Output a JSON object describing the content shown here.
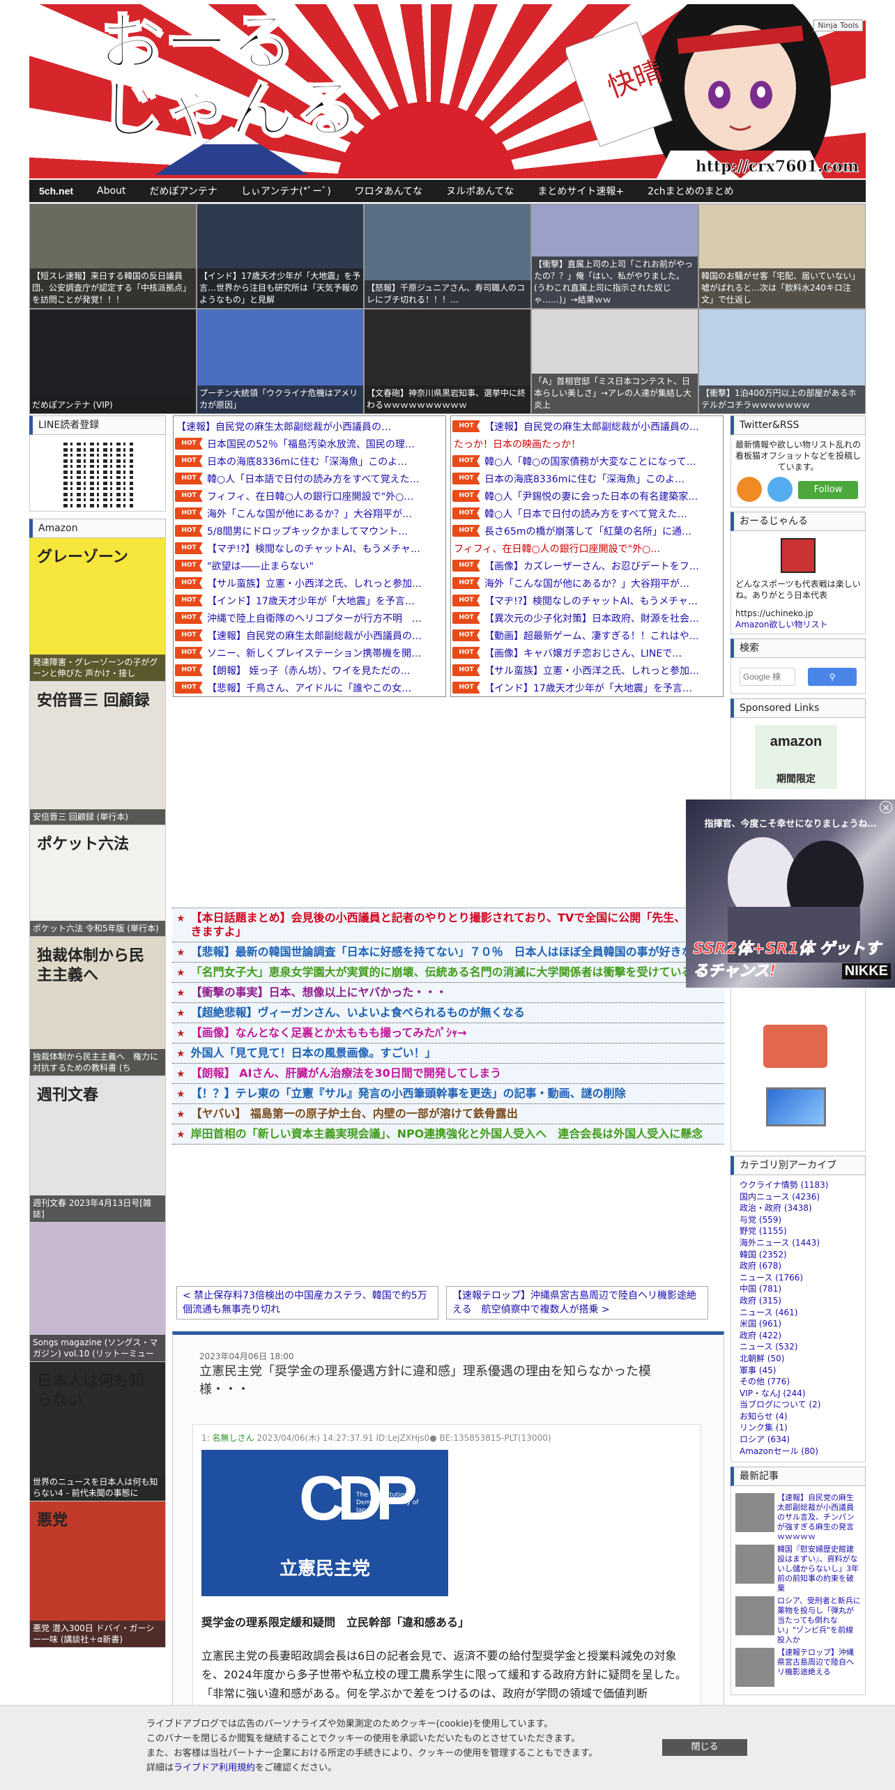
{
  "header": {
    "logo_text": "おーる\nじゃんる",
    "url_text": "http://crx7601.com",
    "ninja_tools": "Ninja Tools"
  },
  "nav": [
    "5ch.net",
    "About",
    "だめぽアンテナ",
    "しぃアンテナ(*ﾟーﾟ)",
    "ワロタあんてな",
    "ヌルポあんてな",
    "まとめサイト速報+",
    "2chまとめのまとめ"
  ],
  "thumbs": [
    {
      "caption": "【短スレ速報】来日する韓国の反日議員団、公安調査庁が認定する「中核派拠点」を訪問ことが発覚！！！",
      "bg": "#6b6a5f"
    },
    {
      "caption": "【インド】17歳天才少年が「大地震」を予言…世界から注目も研究所は「天気予報のようなもの」と見解",
      "bg": "#2e3b4e"
    },
    {
      "caption": "【怒報】千原ジュニアさん、寿司職人のコレにブチ切れる！！！…",
      "bg": "#5a6e84"
    },
    {
      "caption": "【衝撃】直属上司の上司「これお前がやったの？？」俺「はい、私がやりました。(うわこれ直属上司に指示された奴じゃ……)」→結果ｗｗ",
      "bg": "#9aa0c8"
    },
    {
      "caption": "韓国のお騒がせ客「宅配、届いていない」嘘がばれると…次は「飲料水240キロ注文」で仕返し",
      "bg": "#d9cbb0"
    },
    {
      "caption": "だめぽアンテナ (VIP)",
      "bg": "#1f1f24"
    },
    {
      "caption": "プーチン大統領「ウクライナ危機はアメリカが原因」",
      "bg": "#4a6ec0"
    },
    {
      "caption": "【文春砲】神奈川県黒岩知事、選挙中に終わるｗｗｗｗｗｗｗｗｗｗ",
      "bg": "#2d2b2a"
    },
    {
      "caption": "「A」首相官邸「ミス日本コンテスト、日本らしい美しさ」→アレの人達が集結し大炎上",
      "bg": "#d8d8d8"
    },
    {
      "caption": "【衝撃】1泊400万円以上の部屋があるホテルがコチラｗｗｗｗｗｗｗ",
      "bg": "#bcd0e6"
    }
  ],
  "left": {
    "line_title": "LINE読者登録",
    "amazon_title": "Amazon",
    "books": [
      {
        "caption": "発達障害・グレーゾーンの子がグーンと伸びた 声かけ・接し",
        "cover_text": "グレーゾーン",
        "bg": "#f7e63c"
      },
      {
        "caption": "安倍晋三 回顧録 (単行本)",
        "cover_text": "安倍晋三 回顧録",
        "bg": "#e6e1d8"
      },
      {
        "caption": "ポケット六法 令和5年版 (単行本)",
        "cover_text": "ポケット六法",
        "bg": "#f3f1ee"
      },
      {
        "caption": "独裁体制から民主主義へ　権力に対抗するための教科書 (ち",
        "cover_text": "独裁体制から民主主義へ",
        "bg": "#ddd8c8"
      },
      {
        "caption": "週刊文春 2023年4月13日号[雑誌]",
        "cover_text": "週刊文春",
        "bg": "#e3e3e3"
      },
      {
        "caption": "Songs magazine (ソングス・マガジン) vol.10 (リットーミュー",
        "cover_text": "",
        "bg": "#c8b9d0"
      },
      {
        "caption": "世界のニュースを日本人は何も知らない4 - 前代未聞の事態に",
        "cover_text": "日本人は何も知らない",
        "bg": "#2b2b2b"
      },
      {
        "caption": "悪党 潜入300日 ドバイ・ガーシー一味 (講談社＋α新書)",
        "cover_text": "悪党",
        "bg": "#c23b2a"
      }
    ]
  },
  "hot_left": [
    "【速報】自民党の麻生太郎副総裁が小西議員の…",
    "日本国民の52％「福島汚染水放流、国民の理…",
    "日本の海底8336mに住む「深海魚」このよ…",
    "韓○人「日本語で日付の読み方をすべて覚えた…",
    "フィフィ、在日韓○人の銀行口座開設で\"外○…",
    "海外「こんな国が他にあるか？」大谷翔平が…",
    "5/8間男にドロップキックかましてマウント…",
    "【マヂ!?】検閲なしのチャットAI、もうメチャ…",
    "\"欲望は――止まらない\"",
    "【サル蛮族】立憲・小西洋之氏、しれっと参加…",
    "【インド】17歳天才少年が「大地震」を予言…",
    "沖縄で陸上自衛隊のヘリコプターが行方不明　…",
    "【速報】自民党の麻生太郎副総裁が小西議員の…",
    "ソニー、新しくプレイステーション携帯機を開…",
    "【朗報】 姪っ子（赤ん坊）、ワイを見ただの…",
    "【悲報】千鳥さん、アイドルに「誰やこの女…"
  ],
  "hot_right": [
    {
      "hot": true,
      "text": "【速報】自民党の麻生太郎副総裁が小西議員の…"
    },
    {
      "hot": false,
      "text": "たっか！日本の映画たっか！"
    },
    {
      "hot": true,
      "text": "韓○人「韓○の国家債務が大変なことになって…"
    },
    {
      "hot": true,
      "text": "日本の海底8336mに住む「深海魚」このよ…"
    },
    {
      "hot": true,
      "text": "韓○人「尹錫悦の妻に会った日本の有名建築家…"
    },
    {
      "hot": true,
      "text": "韓○人「日本で日付の読み方をすべて覚えた…"
    },
    {
      "hot": true,
      "text": "長さ65mの橋が崩落して「紅葉の名所」に通…"
    },
    {
      "hot": false,
      "text": "フィフィ、在日韓○人の銀行口座開設で\"外○…"
    },
    {
      "hot": true,
      "text": "【画像】カズレーザーさん、お忍びデートをフ…"
    },
    {
      "hot": true,
      "text": "海外「こんな国が他にあるか？」大谷翔平が…"
    },
    {
      "hot": true,
      "text": "【マヂ!?】検閲なしのチャットAI、もうメチャ…"
    },
    {
      "hot": true,
      "text": "【異次元の少子化対策】日本政府、財源を社会…"
    },
    {
      "hot": true,
      "text": "【動画】超最新ゲーム、凄すぎる！！これはや…"
    },
    {
      "hot": true,
      "text": "【画像】キャバ嬢ガチ恋おじさん、LINEで…"
    },
    {
      "hot": true,
      "text": "【サル蛮族】立憲・小西洋之氏、しれっと参加…"
    },
    {
      "hot": true,
      "text": "【インド】17歳天才少年が「大地震」を予言…"
    }
  ],
  "ranks": [
    {
      "text": "【本日話題まとめ】会見後の小西議員と記者のやりとり撮影されており、TVで全国に公開「先生、これ書きますよ」",
      "color": "#d0021b"
    },
    {
      "text": "【悲報】最新の韓国世論調査「日本に好感を持てない」７０％　日本人はほぼ全員韓国の事が好きなのに",
      "color": "#1a5fb4"
    },
    {
      "text": "「名門女子大」恵泉女学園大が実質的に崩壊、伝統ある名門の消滅に大学関係者は衝撃を受けている",
      "color": "#3f9b19"
    },
    {
      "text": "【衝撃の事実】日本、想像以上にヤバかった・・・",
      "color": "#8e1c8e"
    },
    {
      "text": "【超絶悲報】ヴィーガンさん、いよいよ食べられるものが無くなる",
      "color": "#1a5fb4"
    },
    {
      "text": "【画像】なんとなく足裏とか太ももも撮ってみたﾊﾟｼｬ→",
      "color": "#c2189b"
    },
    {
      "text": "外国人「見て見て！日本の風景画像。すごい！」",
      "color": "#1a5fb4"
    },
    {
      "text": "【朗報】 AIさん、肝臓がん治療法を30日間で開発してしまう",
      "color": "#c2189b"
    },
    {
      "text": "【！？】テレ東の「立憲『サル』発言の小西筆頭幹事を更迭」の記事・動画、謎の削除",
      "color": "#1a5fb4"
    },
    {
      "text": "【ヤバい】 福島第一の原子炉土台、内壁の一部が溶けて鉄骨露出",
      "color": "#7a4a1a"
    },
    {
      "text": "岸田首相の「新しい資本主義実現会議」、NPO連携強化と外国人受入へ　連合会長は外国人受入に懸念",
      "color": "#3f9b19"
    }
  ],
  "pager": {
    "prev": "< 禁止保存料73倍検出の中国産カステラ、韓国で約5万個流通も無事売り切れ",
    "next": "【速報テロップ】沖縄県宮古島周辺で陸自ヘリ機影途絶える　航空偵察中で複数人が搭乗 >"
  },
  "article": {
    "date": "2023年04月06日 18:00",
    "title": "立憲民主党「奨学金の理系優遇方針に違和感」理系優遇の理由を知らなかった模様・・・",
    "post_no": "1:",
    "post_name": "名無しさん",
    "post_meta": "2023/04/06(木) 14:27:37.91 ID:LejZXHjs0● BE:135853815-PLT(13000)",
    "logo_mark": "CDP",
    "logo_en": "The Constitutional Democratic Party of Japan",
    "logo_jp": "立憲民主党",
    "headline": "奨学金の理系限定緩和疑問　立民幹部「違和感ある」",
    "body": "立憲民主党の長妻昭政調会長は6日の記者会見で、返済不要の給付型奨学金と授業料減免の対象を、2024年度から多子世帯や私立校の理工農系学生に限って緩和する政府方針に疑問を呈した。「非常に強い違和感がある。何を学ぶかで差をつけるのは、政府が学問の領域で価値判断"
  },
  "right": {
    "rss_title": "Twitter&RSS",
    "rss_text": "最新情報や欲しい物リスト乱れの看板猫オフショットなどを投稿しています。",
    "follow": "Follow",
    "site_title": "おーるじゃんる",
    "site_text": "どんなスポーツも代表戦は楽しいね。ありがとう日本代表",
    "site_link1": "https://uchineko.jp",
    "site_link2": "Amazon欲しい物リスト",
    "search_title": "検索",
    "search_placeholder": "Google 検",
    "sponsored_title": "Sponsored Links",
    "amazon_label": "amazon",
    "period_label": "期間限定",
    "cat_title": "カテゴリ別アーカイブ",
    "categories": [
      "ウクライナ情勢 (1183)",
      "国内ニュース (4236)",
      "政治・政府 (3438)",
      "与党 (559)",
      "野党 (1155)",
      "海外ニュース (1443)",
      "韓国 (2352)",
      "政府 (678)",
      "ニュース (1766)",
      "中国 (781)",
      "政府 (315)",
      "ニュース (461)",
      "米国 (961)",
      "政府 (422)",
      "ニュース (532)",
      "北朝鮮 (50)",
      "軍事 (45)",
      "その他 (776)",
      "VIP・なんJ (244)",
      "当ブログについて (2)",
      "お知らせ (4)",
      "リンク集 (1)",
      "ロシア (634)",
      "Amazonセール (80)"
    ],
    "recent_title": "最新記事",
    "recent": [
      "【速報】自民党の麻生太郎副総裁が小西議員のサル言及、チンパンが強すぎる麻生の発言ｗｗｗｗｗ",
      "韓国『慰安婦歴史館建設はまずい』、資料がないし儲からないし」3年前の前知事の約束を破棄",
      "ロシア、受刑者と新兵に薬物を投与し「弾丸が当たっても倒れない」\"ゾンビ兵\"を前線投入か",
      "【速報テロップ】沖縄県宮古島周辺で陸自ヘリ機影途絶える"
    ]
  },
  "ad": {
    "top_text": "指揮官、今度こそ幸せになりましょうね…",
    "ssr": "SSR2体+SR1体 ゲットするチャンス!",
    "brand": "NIKKE"
  },
  "cookie": {
    "lines": [
      "ライブドアブログでは広告のパーソナライズや効果測定のためクッキー(cookie)を使用しています。",
      "このバナーを閉じるか閲覧を継続することでクッキーの使用を承認いただいたものとさせていただきます。",
      "また、お客様は当社パートナー企業における所定の手続きにより、クッキーの使用を管理することもできます。",
      "詳細は"
    ],
    "link": "ライブドア利用規約",
    "tail": "をご確認ください。",
    "close": "閉じる"
  }
}
